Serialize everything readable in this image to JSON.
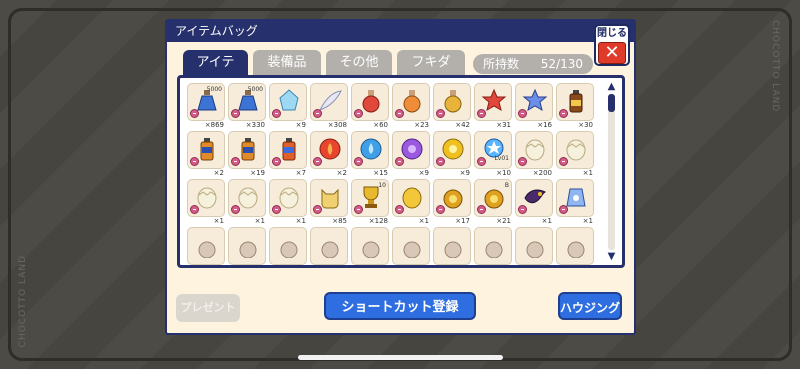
{
  "window": {
    "title": "アイテムバッグ",
    "close_label": "閉じる",
    "close_symbol": "✕"
  },
  "branding": {
    "side_text": "CHOCOTTO LAND"
  },
  "tabs": [
    {
      "label": "アイテム",
      "active": true
    },
    {
      "label": "装備品",
      "active": false
    },
    {
      "label": "その他",
      "active": false
    },
    {
      "label": "フキダシ",
      "active": false
    }
  ],
  "capacity": {
    "label": "所持数",
    "value": "52/130"
  },
  "items": [
    {
      "icon": "blue-potion-icon",
      "qty": "×869",
      "badge": "5000"
    },
    {
      "icon": "blue-potion-icon",
      "qty": "×330",
      "badge": "5000"
    },
    {
      "icon": "ice-crystal-icon",
      "qty": "×9"
    },
    {
      "icon": "wing-feather-icon",
      "qty": "×308"
    },
    {
      "icon": "red-flask-icon",
      "qty": "×60"
    },
    {
      "icon": "orange-flask-icon",
      "qty": "×23"
    },
    {
      "icon": "gold-flask-icon",
      "qty": "×42"
    },
    {
      "icon": "star-flask-icon",
      "qty": "×31"
    },
    {
      "icon": "star-bottle-icon",
      "qty": "×16"
    },
    {
      "icon": "brown-bottle-icon",
      "qty": "×30"
    },
    {
      "icon": "up-bottle-icon",
      "qty": "×2"
    },
    {
      "icon": "up-bottle-icon",
      "qty": "×19"
    },
    {
      "icon": "orange-bottle-icon",
      "qty": "×7"
    },
    {
      "icon": "fire-orb-icon",
      "qty": "×2"
    },
    {
      "icon": "water-orb-icon",
      "qty": "×15"
    },
    {
      "icon": "purple-orb-icon",
      "qty": "×9"
    },
    {
      "icon": "yellow-orb-icon",
      "qty": "×9"
    },
    {
      "icon": "blue-gem-icon",
      "qty": "×10",
      "level": "Lv01"
    },
    {
      "icon": "egg-icon",
      "qty": "×200"
    },
    {
      "icon": "egg-icon",
      "qty": "×1"
    },
    {
      "icon": "egg-icon",
      "qty": "×1"
    },
    {
      "icon": "egg-icon",
      "qty": "×1"
    },
    {
      "icon": "egg-icon",
      "qty": "×1"
    },
    {
      "icon": "gold-cat-icon",
      "qty": "×85"
    },
    {
      "icon": "trophy-icon",
      "qty": "×128",
      "badge": "10"
    },
    {
      "icon": "gold-egg-icon",
      "qty": "×1"
    },
    {
      "icon": "gold-pot-icon",
      "qty": "×17"
    },
    {
      "icon": "gold-pot-icon",
      "qty": "×21",
      "badge": "B"
    },
    {
      "icon": "dark-bird-icon",
      "qty": "×1"
    },
    {
      "icon": "blue-pouch-icon",
      "qty": "×1"
    },
    {
      "icon": "partial-item-icon",
      "qty": ""
    },
    {
      "icon": "partial-item-icon",
      "qty": ""
    },
    {
      "icon": "partial-item-icon",
      "qty": ""
    },
    {
      "icon": "partial-item-icon",
      "qty": ""
    },
    {
      "icon": "partial-item-icon",
      "qty": ""
    },
    {
      "icon": "partial-item-icon",
      "qty": ""
    },
    {
      "icon": "partial-item-icon",
      "qty": ""
    },
    {
      "icon": "partial-item-icon",
      "qty": ""
    },
    {
      "icon": "partial-item-icon",
      "qty": ""
    },
    {
      "icon": "partial-item-icon",
      "qty": ""
    }
  ],
  "buttons": {
    "present": "プレゼント",
    "shortcut": "ショートカット登録",
    "housing": "ハウジング"
  },
  "colors": {
    "navy": "#25306d",
    "accent_blue": "#2f6ee0",
    "close_red": "#e03a2a",
    "panel_cream": "#fdf3de"
  }
}
